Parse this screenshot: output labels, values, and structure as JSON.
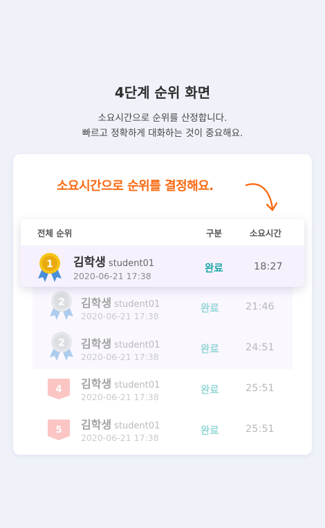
{
  "title": "4단계 순위 화면",
  "description_line1": "소요시간으로 순위를 산정합니다.",
  "description_line2": "빠르고 정확하게 대화하는 것이 중요해요.",
  "callout": "소요시간으로 순위를 결정해요.",
  "colors": {
    "accent": "#f86a12",
    "status": "#18a8a6",
    "highlight_bg": "#f7f1fe",
    "gold": "#f5c518",
    "silver": "#c9ccd3",
    "rank_flag": "#f4807c",
    "ribbon": "#4a8fd8"
  },
  "table": {
    "headers": {
      "rank": "전체 순위",
      "status": "구분",
      "time": "소요시간"
    },
    "highlight": {
      "rank": "1",
      "rank_icon": "gold-medal-icon",
      "name": "김학생",
      "id": "student01",
      "date": "2020-06-21 17:38",
      "status": "완료",
      "time": "18:27"
    },
    "rows": [
      {
        "rank": "2",
        "rank_icon": "silver-medal-icon",
        "name": "김학생",
        "id": "student01",
        "date": "2020-06-21 17:38",
        "status": "완료",
        "time": "21:46"
      },
      {
        "rank": "2",
        "rank_icon": "silver-medal-icon",
        "name": "김학생",
        "id": "student01",
        "date": "2020-06-21 17:38",
        "status": "완료",
        "time": "24:51"
      },
      {
        "rank": "4",
        "rank_icon": "rank-flag-icon",
        "name": "김학생",
        "id": "student01",
        "date": "2020-06-21 17:38",
        "status": "완료",
        "time": "25:51"
      },
      {
        "rank": "5",
        "rank_icon": "rank-flag-icon",
        "name": "김학생",
        "id": "student01",
        "date": "2020-06-21 17:38",
        "status": "완료",
        "time": "25:51"
      }
    ]
  }
}
